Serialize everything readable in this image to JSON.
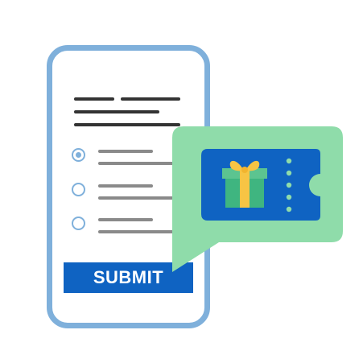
{
  "form": {
    "submit_label": "SUBMIT",
    "selected_option": 1,
    "options": [
      {
        "selected": true
      },
      {
        "selected": false
      },
      {
        "selected": false
      }
    ]
  },
  "colors": {
    "phone_border": "#7fb0db",
    "submit_bg": "#0f63c2",
    "bubble": "#8fdcaa",
    "ticket": "#0f63c2",
    "gift_box": "#3fb580",
    "gift_ribbon": "#f7c444",
    "ticket_dots": "#8fdcaa"
  },
  "icons": {
    "ticket": "gift-voucher-icon",
    "gift": "gift-box-icon",
    "bubble": "speech-bubble-icon"
  }
}
